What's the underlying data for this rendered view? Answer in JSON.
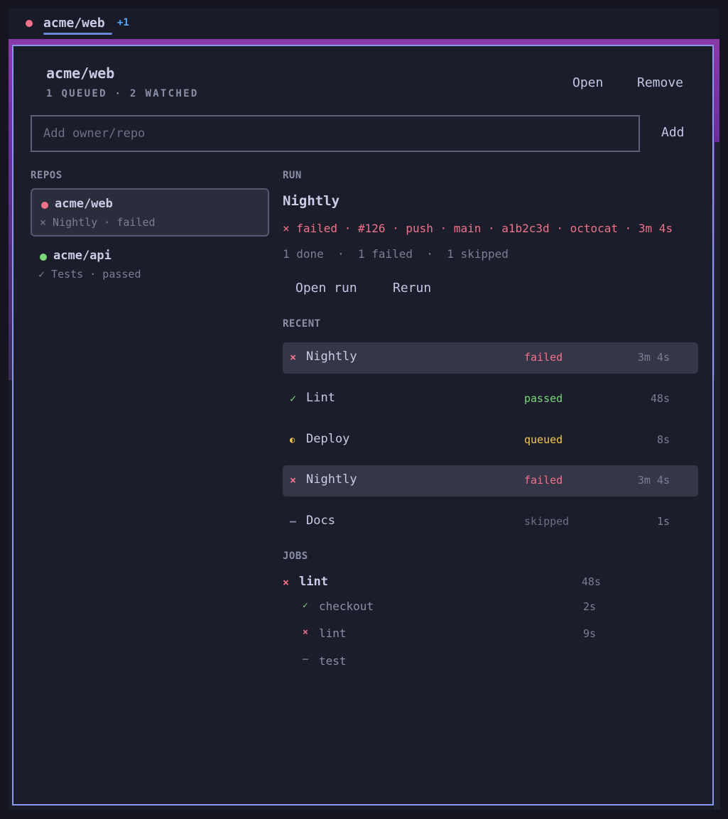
{
  "colors": {
    "failed": "#f0728a",
    "passed": "#79d77a",
    "queued": "#f2c94c",
    "skipped": "#6b6f86",
    "accent": "#8898f0",
    "badge": "#56a8ff"
  },
  "tab": {
    "title": "acme/web",
    "badge": "+1",
    "status_icon": "red-dot-icon"
  },
  "header": {
    "title": "acme/web",
    "subtitle": "1 QUEUED · 2 WATCHED",
    "open_label": "Open",
    "remove_label": "Remove"
  },
  "add": {
    "placeholder": "Add owner/repo",
    "value": "",
    "button_label": "Add"
  },
  "repos": {
    "label": "REPOS",
    "items": [
      {
        "name": "acme/web",
        "status_text": "× Nightly · failed",
        "state": "failed",
        "selected": true
      },
      {
        "name": "acme/api",
        "status_text": "✓ Tests · passed",
        "state": "passed",
        "selected": false
      }
    ]
  },
  "run": {
    "label": "RUN",
    "title": "Nightly",
    "meta": "× failed · #126 · push · main · a1b2c3d · octocat · 3m 4s",
    "counts": "1 done  ·  1 failed  ·  1 skipped",
    "open_run_label": "Open run",
    "rerun_label": "Rerun"
  },
  "recent": {
    "label": "RECENT",
    "items": [
      {
        "icon": "×",
        "name": "Nightly",
        "status": "failed",
        "duration": "3m 4s",
        "highlight": true
      },
      {
        "icon": "✓",
        "name": "Lint",
        "status": "passed",
        "duration": "48s",
        "highlight": false
      },
      {
        "icon": "◐",
        "name": "Deploy",
        "status": "queued",
        "duration": "8s",
        "highlight": false
      },
      {
        "icon": "×",
        "name": "Nightly",
        "status": "failed",
        "duration": "3m 4s",
        "highlight": true
      },
      {
        "icon": "–",
        "name": "Docs",
        "status": "skipped",
        "duration": "1s",
        "highlight": false
      }
    ]
  },
  "jobs": {
    "label": "JOBS",
    "items": [
      {
        "icon": "×",
        "name": "lint",
        "state": "failed",
        "duration": "48s",
        "level": 0
      },
      {
        "icon": "✓",
        "name": "checkout",
        "state": "passed",
        "duration": "2s",
        "level": 1
      },
      {
        "icon": "×",
        "name": "lint",
        "state": "failed",
        "duration": "9s",
        "level": 1
      },
      {
        "icon": "–",
        "name": "test",
        "state": "skipped",
        "duration": "",
        "level": 1
      }
    ]
  }
}
